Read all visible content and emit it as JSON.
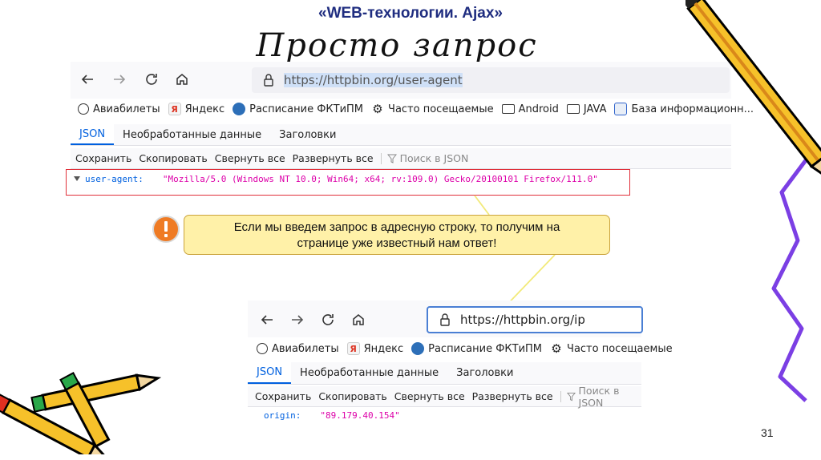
{
  "slide": {
    "subtitle": "«WEB-технологии. Ajax»",
    "title": "Просто запрос",
    "page_number": "31"
  },
  "browser1": {
    "url": "https://httpbin.org/user-agent",
    "bookmarks": [
      {
        "icon": "globe-icon",
        "label": "Авиабилеты"
      },
      {
        "icon": "yandex-icon",
        "label": "Яндекс"
      },
      {
        "icon": "schedule-icon",
        "label": "Расписание ФКТиПМ"
      },
      {
        "icon": "gear-icon",
        "label": "Часто посещаемые"
      },
      {
        "icon": "folder-icon",
        "label": "Android"
      },
      {
        "icon": "folder-icon",
        "label": "JAVA"
      },
      {
        "icon": "database-icon",
        "label": "База информационн..."
      }
    ],
    "tabs": [
      "JSON",
      "Необработанные данные",
      "Заголовки"
    ],
    "toolbar": [
      "Сохранить",
      "Скопировать",
      "Свернуть все",
      "Развернуть все"
    ],
    "filter_placeholder": "Поиск в JSON",
    "json": {
      "key": "user-agent:",
      "value": "\"Mozilla/5.0 (Windows NT 10.0; Win64; x64; rv:109.0) Gecko/20100101 Firefox/111.0\""
    }
  },
  "callout": {
    "line1": "Если мы введем запрос в адресную строку, то получим на",
    "line2": "странице уже известный нам ответ!"
  },
  "browser2": {
    "url": "https://httpbin.org/ip",
    "bookmarks": [
      {
        "icon": "globe-icon",
        "label": "Авиабилеты"
      },
      {
        "icon": "yandex-icon",
        "label": "Яндекс"
      },
      {
        "icon": "schedule-icon",
        "label": "Расписание ФКТиПМ"
      },
      {
        "icon": "gear-icon",
        "label": "Часто посещаемые"
      }
    ],
    "tabs": [
      "JSON",
      "Необработанные данные",
      "Заголовки"
    ],
    "toolbar": [
      "Сохранить",
      "Скопировать",
      "Свернуть все",
      "Развернуть все"
    ],
    "filter_placeholder": "Поиск в JSON",
    "json": {
      "key": "origin:",
      "value": "\"89.179.40.154\""
    }
  },
  "colors": {
    "accent": "#0060df",
    "json_value": "#dd00a9",
    "callout_bg": "#fff1a8",
    "highlight_box": "#e0303a"
  }
}
